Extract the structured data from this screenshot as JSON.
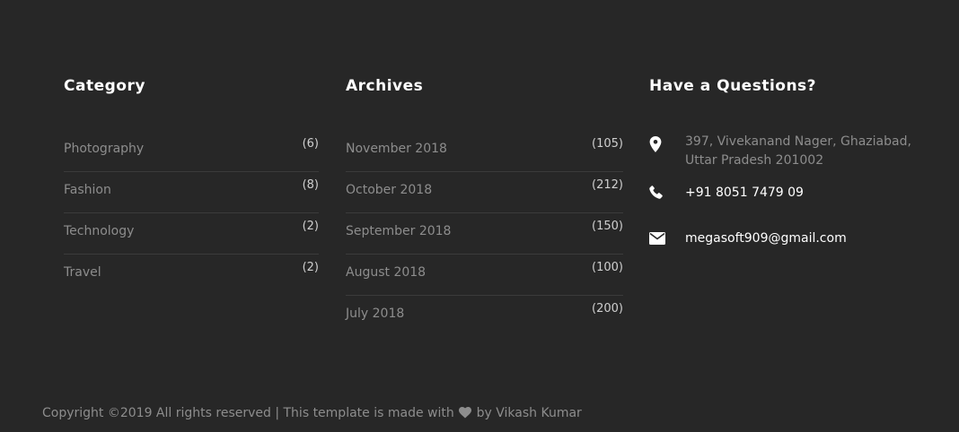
{
  "category": {
    "heading": "Category",
    "items": [
      {
        "label": "Photography",
        "count": "(6)"
      },
      {
        "label": "Fashion",
        "count": "(8)"
      },
      {
        "label": "Technology",
        "count": "(2)"
      },
      {
        "label": "Travel",
        "count": "(2)"
      }
    ]
  },
  "archives": {
    "heading": "Archives",
    "items": [
      {
        "label": "November 2018",
        "count": "(105)"
      },
      {
        "label": "October 2018",
        "count": "(212)"
      },
      {
        "label": "September 2018",
        "count": "(150)"
      },
      {
        "label": "August 2018",
        "count": "(100)"
      },
      {
        "label": "July 2018",
        "count": "(200)"
      }
    ]
  },
  "contact": {
    "heading": "Have a Questions?",
    "address_line1": "397, Vivekanand Nager, Ghaziabad,",
    "address_line2": "Uttar Pradesh 201002",
    "phone": "+91 8051 7479 09",
    "email": "megasoft909@gmail.com",
    "icons": {
      "address": "map-marker-icon",
      "phone": "phone-icon",
      "email": "envelope-icon"
    }
  },
  "footer": {
    "copyright_prefix": "Copyright ©2019 All rights reserved | This template is made with",
    "copyright_by": "by",
    "author": "Vikash Kumar",
    "heart_icon": "heart-icon"
  },
  "colors": {
    "background": "#272727",
    "heading": "#ffffff",
    "muted_text": "#8d8d8d",
    "divider": "#3b3b3b"
  }
}
